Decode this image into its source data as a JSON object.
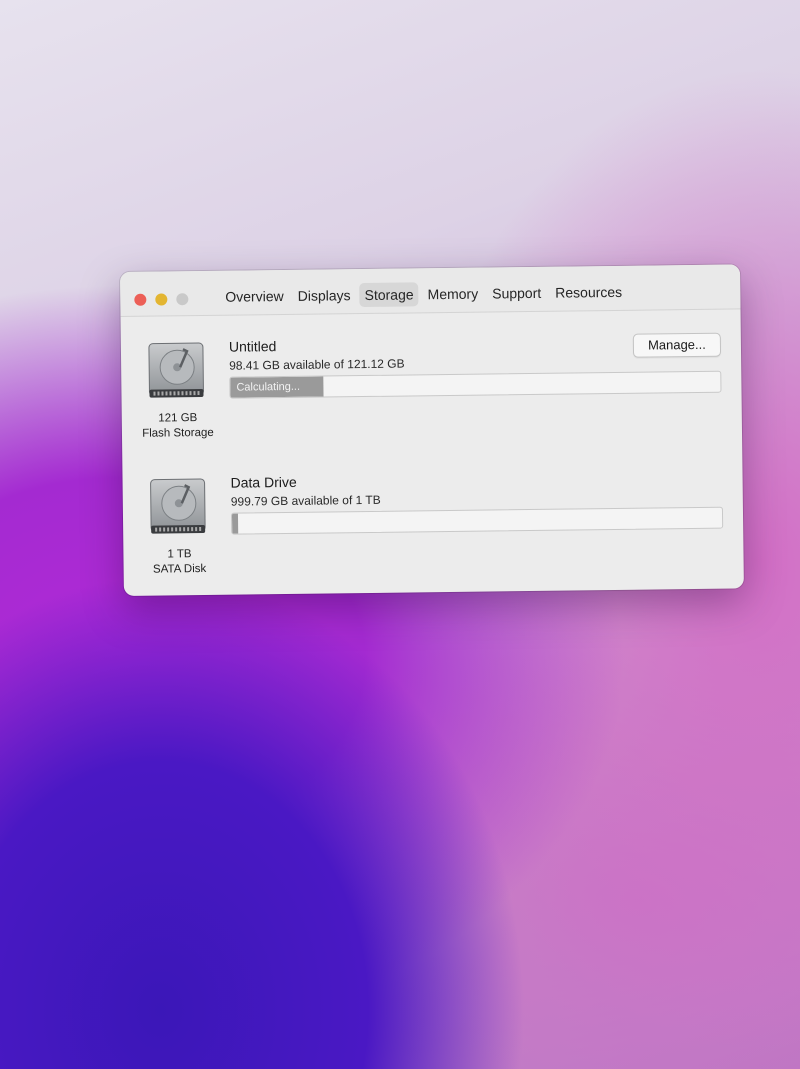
{
  "window": {
    "tabs": [
      {
        "label": "Overview",
        "active": false
      },
      {
        "label": "Displays",
        "active": false
      },
      {
        "label": "Storage",
        "active": true
      },
      {
        "label": "Memory",
        "active": false
      },
      {
        "label": "Support",
        "active": false
      },
      {
        "label": "Resources",
        "active": false
      }
    ]
  },
  "disks": [
    {
      "icon": "hard-disk-icon",
      "capacity": "121 GB",
      "type": "Flash Storage",
      "name": "Untitled",
      "available": "98.41 GB available of 121.12 GB",
      "bar_label": "Calculating...",
      "bar_fraction": 0.19,
      "manage_label": "Manage..."
    },
    {
      "icon": "hard-disk-icon",
      "capacity": "1 TB",
      "type": "SATA Disk",
      "name": "Data Drive",
      "available": "999.79 GB available of 1 TB",
      "bar_fraction": 0.0
    }
  ],
  "colors": {
    "close": "#ec5f57",
    "minimize": "#e3b531",
    "zoom_disabled": "#c9c9c9",
    "bar_fill": "#9a9a9a"
  }
}
